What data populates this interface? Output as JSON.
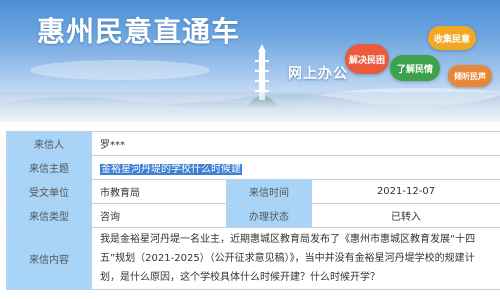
{
  "header": {
    "site_title": "惠州民意直通车",
    "online_office": "网上办公",
    "bubbles": {
      "collect": "收集民意",
      "solve": "解决民困",
      "know": "了解民情",
      "listen": "倾听民声"
    }
  },
  "letter": {
    "sender_label": "来信人",
    "sender_value": "罗***",
    "subject_label": "来信主题",
    "subject_value": "金裕星河丹堤的学校什么时候建",
    "dept_label": "受文单位",
    "dept_value": "市教育局",
    "time_label": "来信时间",
    "time_value": "2021-12-07",
    "type_label": "来信类型",
    "type_value": "咨询",
    "status_label": "办理状态",
    "status_value": "已转入",
    "content_label": "来信内容",
    "content_value": "我是金裕星河丹堤一名业主，近期惠城区教育局发布了《惠州市惠城区教育发展“十四五”规划（2021-2025）（公开征求意见稿）》，当中并没有金裕星河丹堤学校的规建计划，是什么原因，这个学校具体什么时候开建？什么时候开学？"
  },
  "colors": {
    "label_bg": "#a8d4f7",
    "border": "#bcd0e6",
    "highlight": "#3f80d4",
    "banner_top": "#4d8fd6"
  }
}
